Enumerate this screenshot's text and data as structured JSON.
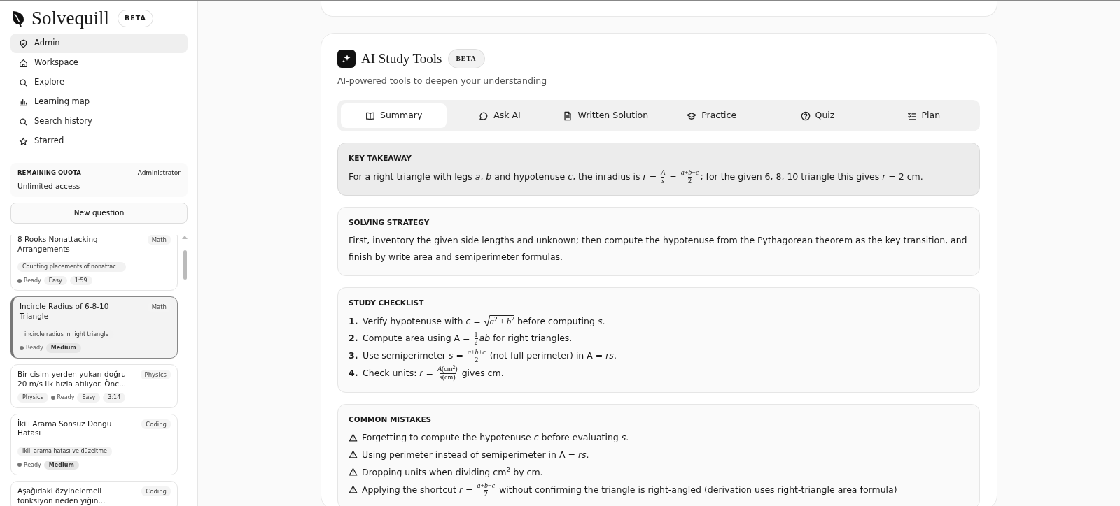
{
  "brand": {
    "name": "Solvequill",
    "badge": "BETA"
  },
  "nav": [
    {
      "label": "Admin",
      "selected": true
    },
    {
      "label": "Workspace",
      "selected": false
    },
    {
      "label": "Explore",
      "selected": false
    },
    {
      "label": "Learning map",
      "selected": false
    },
    {
      "label": "Search history",
      "selected": false
    },
    {
      "label": "Starred",
      "selected": false
    }
  ],
  "quota": {
    "label": "REMAINING QUOTA",
    "role": "Administrator",
    "value": "Unlimited access"
  },
  "new_question": "New question",
  "questions": [
    {
      "title": "8 Rooks Nonattacking Arrangements",
      "tag": "Math",
      "topic": "Counting placements of nonattac...",
      "selected": false,
      "meta": [
        {
          "kind": "status",
          "text": "Ready"
        },
        {
          "kind": "chip",
          "text": "Easy"
        },
        {
          "kind": "chip",
          "text": "1:59"
        }
      ]
    },
    {
      "title": "Incircle Radius of 6-8-10 Triangle",
      "tag": "Math",
      "topic": "incircle radius in right triangle",
      "selected": true,
      "meta": [
        {
          "kind": "status",
          "text": "Ready"
        },
        {
          "kind": "strong",
          "text": "Medium"
        }
      ]
    },
    {
      "title": "Bir cisim yerden yukarı doğru 20 m/s ilk hızla atılıyor. Önc...",
      "tag": "Physics",
      "selected": false,
      "meta": [
        {
          "kind": "chip",
          "text": "Physics"
        },
        {
          "kind": "status",
          "text": "Ready"
        },
        {
          "kind": "chip",
          "text": "Easy"
        },
        {
          "kind": "chip",
          "text": "3:14"
        }
      ]
    },
    {
      "title": "İkili Arama Sonsuz Döngü Hatası",
      "tag": "Coding",
      "topic": "ikili arama hatası ve düzeltme",
      "selected": false,
      "meta": [
        {
          "kind": "status",
          "text": "Ready"
        },
        {
          "kind": "strong",
          "text": "Medium"
        }
      ]
    },
    {
      "title": "Aşağıdaki özyinelemeli fonksiyon neden yığın...",
      "tag": "Coding",
      "selected": false
    }
  ],
  "tools": {
    "title": "AI Study Tools",
    "badge": "BETA",
    "subtitle": "AI-powered tools to deepen your understanding",
    "tabs": [
      {
        "label": "Summary",
        "selected": true
      },
      {
        "label": "Ask AI",
        "selected": false
      },
      {
        "label": "Written Solution",
        "selected": false
      },
      {
        "label": "Practice",
        "selected": false
      },
      {
        "label": "Quiz",
        "selected": false
      },
      {
        "label": "Plan",
        "selected": false
      }
    ]
  },
  "sections": [
    {
      "title": "KEY TAKEAWAY",
      "kind": "paragraph",
      "emphasized": true,
      "items": [
        [
          "For a right triangle with legs *a*, *b* and hypotenuse *c*, the inradius is *r* = ",
          {
            "kind": "frac",
            "num": "*A*",
            "den": "*s*"
          },
          " = ",
          {
            "kind": "frac",
            "num": "*a*+*b*−*c*",
            "den": "2"
          },
          "; for the given 6, 8, 10 triangle this gives *r* = 2 cm."
        ]
      ]
    },
    {
      "title": "SOLVING STRATEGY",
      "kind": "paragraph",
      "emphasized": false,
      "items": [
        [
          "First, inventory the given side lengths and unknown; then compute the hypotenuse from the Pythagorean theorem as the key transition, and finish by write area and semiperimeter formulas."
        ]
      ]
    },
    {
      "title": "STUDY CHECKLIST",
      "kind": "numbered",
      "emphasized": false,
      "numbers": [
        "1.",
        "2.",
        "3.",
        "4."
      ],
      "items": [
        [
          "Verify hypotenuse with *c* = ",
          {
            "kind": "sqrt",
            "body": "*a*$^{2}$ + *b*$^{2}$"
          },
          " before computing *s*."
        ],
        [
          "Compute area using A = ",
          {
            "kind": "frac",
            "num": "1",
            "den": "2"
          },
          "*ab* for right triangles."
        ],
        [
          "Use semiperimeter *s* = ",
          {
            "kind": "frac",
            "num": "*a*+*b*+*c*",
            "den": "2"
          },
          " (not full perimeter) in A = *rs*."
        ],
        [
          "Check units: *r* = ",
          {
            "kind": "frac",
            "num": "*A*(cm$^{2}$)",
            "den": "*s*(cm)"
          },
          " gives cm."
        ]
      ]
    },
    {
      "title": "COMMON MISTAKES",
      "kind": "warnings",
      "emphasized": false,
      "items": [
        [
          "Forgetting to compute the hypotenuse *c* before evaluating *s*."
        ],
        [
          "Using perimeter instead of semiperimeter in A = *rs*."
        ],
        [
          "Dropping units when dividing cm$^{2}$ by cm."
        ],
        [
          "Applying the shortcut *r* = ",
          {
            "kind": "frac",
            "num": "*a*+*b*−*c*",
            "den": "2"
          },
          " without confirming the triangle is right-angled (derivation uses right-triangle area formula)"
        ]
      ]
    }
  ]
}
